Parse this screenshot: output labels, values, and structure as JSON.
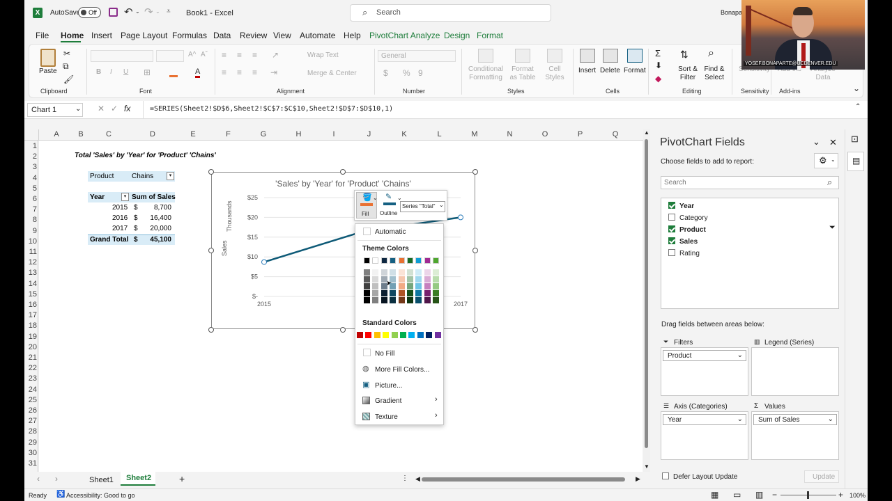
{
  "titlebar": {
    "autosave": "AutoSave",
    "toggle": "Off",
    "doc_title": "Book1 - Excel",
    "search_placeholder": "Search",
    "user": "Bonapa"
  },
  "menu_tabs": [
    "File",
    "Home",
    "Insert",
    "Page Layout",
    "Formulas",
    "Data",
    "Review",
    "View",
    "Automate",
    "Help",
    "PivotChart Analyze",
    "Design",
    "Format"
  ],
  "ribbon": {
    "paste": "Paste",
    "wrap_text": "Wrap Text",
    "merge_center": "Merge & Center",
    "number_format": "General",
    "conditional_formatting": "Conditional Formatting",
    "format_as_table": "Format as Table",
    "cell_styles": "Cell Styles",
    "insert": "Insert",
    "delete": "Delete",
    "format": "Format",
    "sort_filter": "Sort & Filter",
    "find_select": "Find & Select",
    "sensitivity": "Sensitivity",
    "add_ins": "Add-ins",
    "analyze_data": "Analyze Data",
    "groups": [
      "Clipboard",
      "Font",
      "Alignment",
      "Number",
      "Styles",
      "Cells",
      "Editing",
      "Sensitivity",
      "Add-ins"
    ]
  },
  "formula_bar": {
    "name_box": "Chart 1",
    "fx": "fx",
    "formula": "=SERIES(Sheet2!$D$6,Sheet2!$C$7:$C$10,Sheet2!$D$7:$D$10,1)"
  },
  "columns": [
    "A",
    "B",
    "C",
    "D",
    "E",
    "F",
    "G",
    "H",
    "I",
    "J",
    "K",
    "L",
    "M",
    "N",
    "O",
    "P",
    "Q"
  ],
  "rows": [
    "1",
    "2",
    "3",
    "4",
    "5",
    "6",
    "7",
    "8",
    "9",
    "10",
    "11",
    "12",
    "13",
    "14",
    "15",
    "16",
    "17",
    "18",
    "19",
    "20",
    "21",
    "22",
    "23",
    "24",
    "25",
    "26",
    "27",
    "28",
    "29",
    "30",
    "31"
  ],
  "sheet": {
    "heading": "Total 'Sales' by 'Year' for 'Product' 'Chains'",
    "filter_label": "Product",
    "filter_value": "Chains",
    "hdr_year": "Year",
    "hdr_sum": "Sum of Sales",
    "pivot_rows": [
      {
        "year": "2015",
        "cur": "$",
        "val": "8,700"
      },
      {
        "year": "2016",
        "cur": "$",
        "val": "16,400"
      },
      {
        "year": "2017",
        "cur": "$",
        "val": "20,000"
      }
    ],
    "grand_label": "Grand Total",
    "grand_cur": "$",
    "grand_val": "45,100"
  },
  "chart_data": {
    "type": "line",
    "title": "'Sales' by 'Year' for 'Product' 'Chains'",
    "ylabel": "Sales",
    "units_label": "Thousands",
    "categories": [
      "2015",
      "2016",
      "2017"
    ],
    "x_labels_visible": [
      "2015",
      "2017"
    ],
    "series": [
      {
        "name": "Total",
        "values": [
          8.7,
          16.4,
          20.0
        ]
      }
    ],
    "yticks": [
      "$-",
      "$5",
      "$10",
      "$15",
      "$20",
      "$25"
    ],
    "ylim": [
      0,
      25
    ],
    "color": "#0e5a77"
  },
  "format_popup": {
    "fill": "Fill",
    "outline": "Outline",
    "series_select": "Series \"Total\""
  },
  "fill_menu": {
    "automatic": "Automatic",
    "theme_colors": "Theme Colors",
    "theme_swatches": [
      "#000000",
      "#ffffff",
      "#0e2841",
      "#156082",
      "#e97132",
      "#196b24",
      "#0f9ed5",
      "#a02b93",
      "#4ea72e"
    ],
    "standard_colors": "Standard Colors",
    "standard_swatches": [
      "#c00000",
      "#ff0000",
      "#ffc000",
      "#ffff00",
      "#92d050",
      "#00b050",
      "#00b0f0",
      "#0070c0",
      "#002060",
      "#7030a0"
    ],
    "no_fill": "No Fill",
    "more_fill_colors": "More Fill Colors...",
    "picture": "Picture...",
    "gradient": "Gradient",
    "texture": "Texture"
  },
  "pivot_pane": {
    "title": "PivotChart Fields",
    "subtitle": "Choose fields to add to report:",
    "search_placeholder": "Search",
    "fields": [
      {
        "name": "Year",
        "checked": true
      },
      {
        "name": "Category",
        "checked": false
      },
      {
        "name": "Product",
        "checked": true
      },
      {
        "name": "Sales",
        "checked": true
      },
      {
        "name": "Rating",
        "checked": false
      }
    ],
    "drag_hint": "Drag fields between areas below:",
    "filters": "Filters",
    "filters_item": "Product",
    "legend": "Legend (Series)",
    "axis": "Axis (Categories)",
    "axis_item": "Year",
    "values": "Values",
    "values_item": "Sum of Sales",
    "defer": "Defer Layout Update",
    "update": "Update"
  },
  "sheets": [
    "Sheet1",
    "Sheet2"
  ],
  "status": {
    "ready": "Ready",
    "accessibility": "Accessibility: Good to go",
    "zoom": "100%"
  },
  "video_caption": "YOSEF.BONAPARTE@UCDENVER.EDU"
}
